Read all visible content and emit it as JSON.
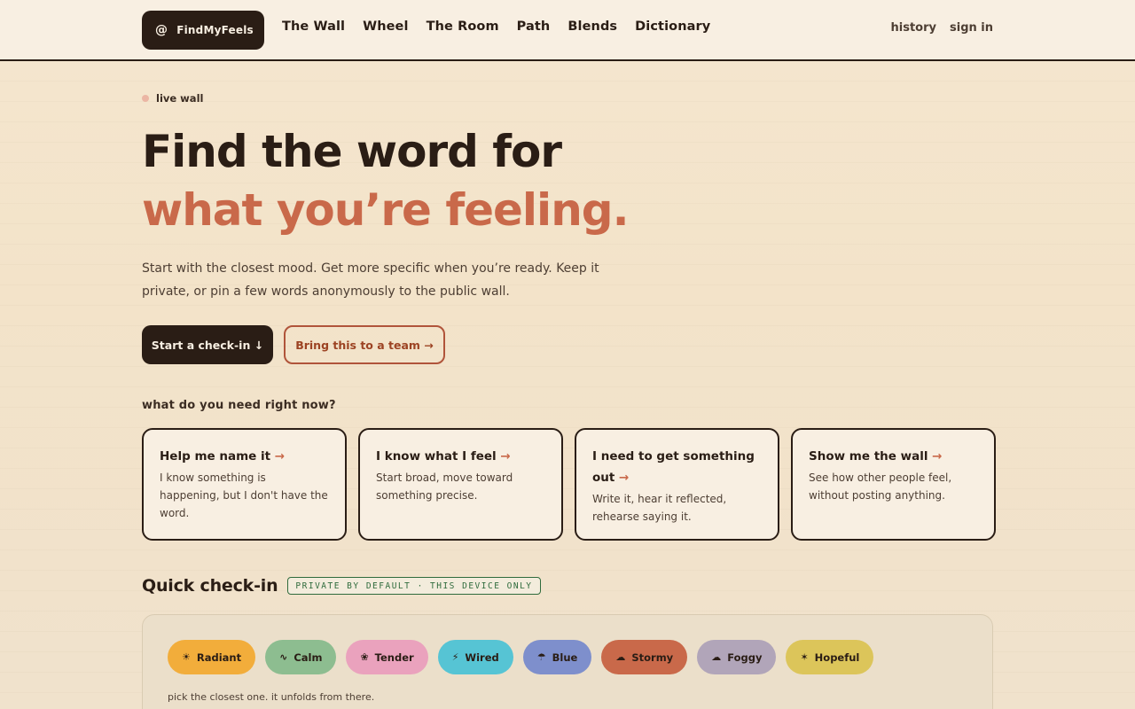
{
  "brand": {
    "name": "FindMyFeels",
    "icon": "spiral-icon"
  },
  "nav": {
    "items": [
      "The Wall",
      "Wheel",
      "The Room",
      "Path",
      "Blends",
      "Dictionary"
    ],
    "history": "history",
    "signin": "sign in"
  },
  "hero": {
    "live_label": "live wall",
    "title_line1": "Find the word for",
    "title_line2": "what you’re feeling.",
    "lede": "Start with the closest mood. Get more specific when you’re ready. Keep it private, or pin a few words anonymously to the public wall.",
    "cta_primary": "Start a check-in ↓",
    "cta_secondary": "Bring this to a team →"
  },
  "needs": {
    "heading": "what do you need right now?",
    "cards": [
      {
        "title": "Help me name it",
        "desc": "I know something is happening, but I don't have the word."
      },
      {
        "title": "I know what I feel",
        "desc": "Start broad, move toward something precise."
      },
      {
        "title": "I need to get something out",
        "desc": "Write it, hear it reflected, rehearse saying it."
      },
      {
        "title": "Show me the wall",
        "desc": "See how other people feel, without posting anything."
      }
    ],
    "arrow": "→"
  },
  "quick_checkin": {
    "title": "Quick check-in",
    "badge": "PRIVATE BY DEFAULT · THIS DEVICE ONLY",
    "hint": "pick the closest one. it unfolds from there.",
    "moods": [
      {
        "label": "Radiant",
        "glyph": "☀",
        "icon": "sun-icon",
        "color": "#f2ad3b"
      },
      {
        "label": "Calm",
        "glyph": "∿",
        "icon": "wave-icon",
        "color": "#8dbd90"
      },
      {
        "label": "Tender",
        "glyph": "❀",
        "icon": "flower-icon",
        "color": "#eaa2bd"
      },
      {
        "label": "Wired",
        "glyph": "⚡",
        "icon": "bolt-icon",
        "color": "#56c4d4"
      },
      {
        "label": "Blue",
        "glyph": "☂",
        "icon": "umbrella-icon",
        "color": "#7e8fcc"
      },
      {
        "label": "Stormy",
        "glyph": "☁",
        "icon": "storm-cloud-icon",
        "color": "#c9694a"
      },
      {
        "label": "Foggy",
        "glyph": "☁",
        "icon": "cloud-icon",
        "color": "#b1a5b9"
      },
      {
        "label": "Hopeful",
        "glyph": "✶",
        "icon": "sparkle-icon",
        "color": "#dcc55a"
      }
    ]
  },
  "colors": {
    "ink": "#2a1d15",
    "accent": "#c9694a",
    "paper": "#f8efe2",
    "private_green": "#2f6b3c"
  }
}
